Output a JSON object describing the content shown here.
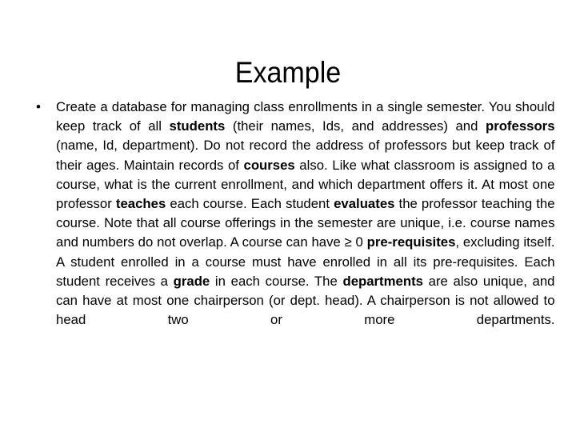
{
  "slide": {
    "title": "Example",
    "background_color": "#ffffff",
    "text_color": "#000000",
    "bullet_marker": "•",
    "body_segments": [
      {
        "text": "Create a database for managing class enrollments in a single semester. You should keep track of all ",
        "bold": false
      },
      {
        "text": "students",
        "bold": true
      },
      {
        "text": " (their names, Ids, and addresses) and ",
        "bold": false
      },
      {
        "text": "professors",
        "bold": true
      },
      {
        "text": " (name, Id, department). Do not record the address of professors but keep track of their ages. Maintain records of ",
        "bold": false
      },
      {
        "text": "courses",
        "bold": true
      },
      {
        "text": " also. Like what classroom is assigned to a course, what is the current enrollment, and which department offers it. At most one professor ",
        "bold": false
      },
      {
        "text": "teaches",
        "bold": true
      },
      {
        "text": " each course. Each student ",
        "bold": false
      },
      {
        "text": "evaluates",
        "bold": true
      },
      {
        "text": " the professor teaching the course. Note that all course offerings in the semester are unique, i.e. course names and numbers do not overlap. A course can have ≥ 0 ",
        "bold": false
      },
      {
        "text": "pre-requisites",
        "bold": true
      },
      {
        "text": ", excluding itself. A student enrolled in a course must have enrolled in all its pre-requisites. Each student receives a ",
        "bold": false
      },
      {
        "text": "grade",
        "bold": true
      },
      {
        "text": " in each course. The ",
        "bold": false
      },
      {
        "text": "departments",
        "bold": true
      },
      {
        "text": " are also unique, and can have at most one chairperson (or dept. head). A chairperson is not allowed to head two or more departments.",
        "bold": false
      }
    ],
    "body_plain_text": "Create a database for managing class enrollments in a single semester. You should keep track of all students (their names, Ids, and addresses) and professors (name, Id, department). Do not record the address of professors but keep track of their ages. Maintain records of courses also. Like what classroom is assigned to a course, what is the current enrollment, and which department offers it. At most one professor teaches each course. Each student evaluates the professor teaching the course. Note that all course offerings in the semester are unique, i.e. course names and numbers do not overlap. A course can have ≥ 0 pre-requisites, excluding itself. A student enrolled in a course must have enrolled in all its pre-requisites. Each student receives a grade in each course. The departments are also unique, and can have at most one chairperson (or dept. head). A chairperson is not allowed to head two or more departments."
  }
}
